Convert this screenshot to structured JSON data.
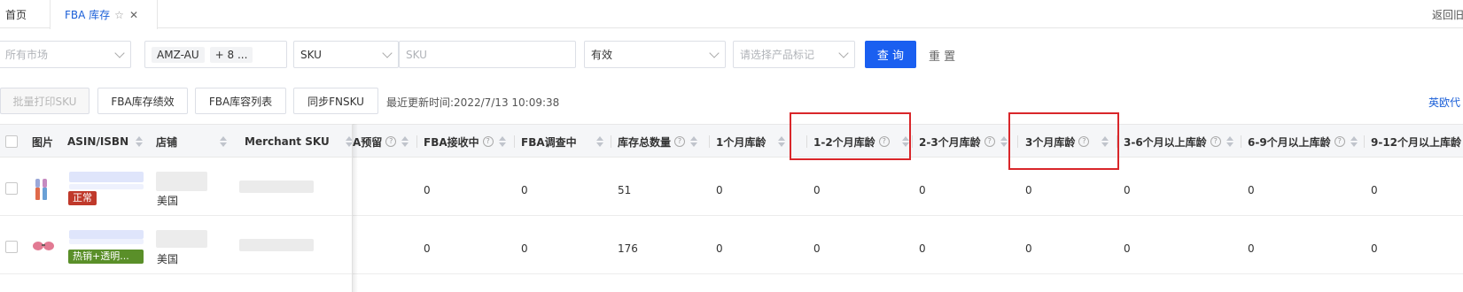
{
  "tabs": {
    "home": "首页",
    "active": "FBA 库存",
    "return_label": "返回旧"
  },
  "filters": {
    "market_placeholder": "所有市场",
    "store_tag": "AMZ-AU",
    "store_more": "+ 8 ...",
    "field_select": "SKU",
    "field_input_placeholder": "SKU",
    "status_select": "有效",
    "tag_placeholder": "请选择产品标记",
    "query_button": "查 询",
    "reset_button": "重 置"
  },
  "actions": {
    "batch_print": "批量打印SKU",
    "performance": "FBA库存绩效",
    "capacity": "FBA库容列表",
    "sync_fnsku": "同步FNSKU",
    "last_update": "最近更新时间:2022/7/13 10:09:38",
    "eu_link": "英欧代"
  },
  "columns": {
    "image": "图片",
    "asin": "ASIN/ISBN",
    "shop": "店铺",
    "merchant_sku": "Merchant SKU",
    "reserved": "A预留",
    "receiving": "FBA接收中",
    "researching": "FBA调查中",
    "total": "库存总数量",
    "age_1m": "1个月库龄",
    "age_1_2m": "1-2个月库龄",
    "age_2_3m": "2-3个月库龄",
    "age_3m": "3个月库龄",
    "age_3_6m": "3-6个月以上库龄",
    "age_6_9m": "6-9个月以上库龄",
    "age_9_12m": "9-12个月以上库龄"
  },
  "rows": [
    {
      "status_badge": "正常",
      "status_color": "#c0392b",
      "country": "美国",
      "receiving": "0",
      "researching": "0",
      "total": "51",
      "age_1m": "0",
      "age_1_2m": "0",
      "age_2_3m": "0",
      "age_3m": "0",
      "age_3_6m": "0",
      "age_6_9m": "0",
      "age_9_12m": "0"
    },
    {
      "status_badge": "热销+透明...",
      "status_color": "#5a8f29",
      "country": "美国",
      "receiving": "0",
      "researching": "0",
      "total": "176",
      "age_1m": "0",
      "age_1_2m": "0",
      "age_2_3m": "0",
      "age_3m": "0",
      "age_3_6m": "0",
      "age_6_9m": "0",
      "age_9_12m": "0"
    }
  ],
  "colors": {
    "accent": "#1a5ff0",
    "highlight": "#d9262a"
  }
}
